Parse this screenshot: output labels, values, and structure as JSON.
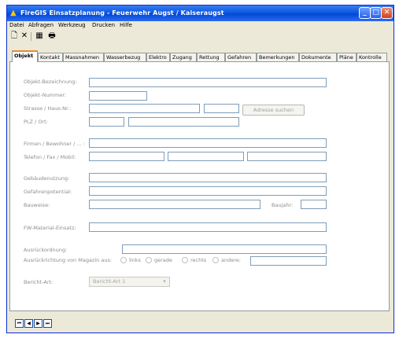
{
  "window": {
    "title": "FireGIS Einsatzplanung  -  Feuerwehr Augst / Kaiseraugst",
    "minimize": "_",
    "maximize": "□",
    "close": "✕"
  },
  "menu": [
    "Datei",
    "Abfragen",
    "Werkzeug",
    "Drucken",
    "Hilfe"
  ],
  "toolbar": {
    "new_icon": "new-document-icon",
    "delete_icon": "delete-x-icon",
    "list_icon": "table-list-icon",
    "print_icon": "printer-icon",
    "new_glyph": "🗋",
    "delete_glyph": "✕",
    "list_glyph": "▦",
    "print_glyph": "🖶"
  },
  "tabs": [
    "Objekt",
    "Kontakt",
    "Massnahmen",
    "Wasserbezug",
    "Elektro",
    "Zugang",
    "Rettung",
    "Gefahren",
    "Bemerkungen",
    "Dokumente",
    "Pläne",
    "Kontrolle"
  ],
  "form": {
    "objekt_bezeichnung": "Objekt-Bezeichnung:",
    "objekt_nummer": "Objekt-Nummer:",
    "strasse": "Strasse / Haus-Nr.:",
    "adresse_suchen": "Adresse suchen",
    "plz_ort": "PLZ / Ort:",
    "firmen": "Firmen / Bewohner / ... :",
    "telefon": "Telefon / Fax / Mobil:",
    "gebaeudenutzung": "Gebäudenutzung:",
    "gefahrenpotential": "Gefahrenpotential:",
    "bauweise": "Bauweise:",
    "baujahr": "Baujahr:",
    "fw_material": "FW-Material-Einsatz:",
    "ausrueckordnung": "Ausrückordnung:",
    "ausrueckrichtung": "Ausrückrichtung von Magazin aus:",
    "radio_links": "links",
    "radio_gerade": "gerade",
    "radio_rechts": "rechts",
    "radio_andere": "andere:",
    "bericht_art": "Bericht-Art:",
    "bericht_art_value": "Bericht-Art 1"
  },
  "nav": [
    "⏮",
    "◀",
    "▶",
    "⏭"
  ]
}
